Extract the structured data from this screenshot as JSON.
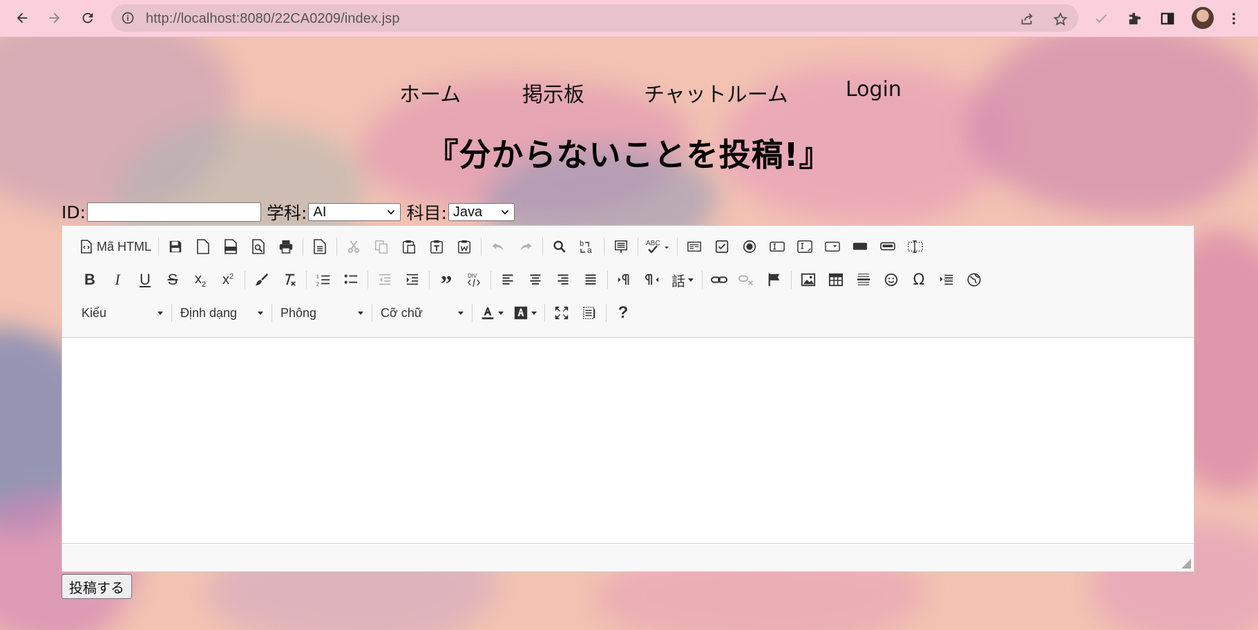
{
  "browser": {
    "url": "http://localhost:8080/22CA0209/index.jsp"
  },
  "nav": {
    "home": "ホーム",
    "board": "掲示板",
    "chat": "チャットルーム",
    "login": "Login"
  },
  "page": {
    "headline": "『分からないことを投稿!』"
  },
  "form": {
    "id_label": "ID:",
    "id_value": "",
    "dept_label": "学科:",
    "dept_selected": "AI",
    "subject_label": "科目:",
    "subject_selected": "Java",
    "submit_label": "投稿する"
  },
  "editor": {
    "source_label": "Mã HTML",
    "combo_style": "Kiểu",
    "combo_format": "Định dạng",
    "combo_font": "Phông",
    "combo_size": "Cỡ chữ",
    "lang_glyph": "話",
    "help_glyph": "?"
  },
  "colors": {
    "chrome_bg": "#fbd0dc",
    "omnibox_bg": "#e8c2cc",
    "toolbar_bg": "#f8f8f8",
    "page_bg": "#f2c2b2"
  }
}
